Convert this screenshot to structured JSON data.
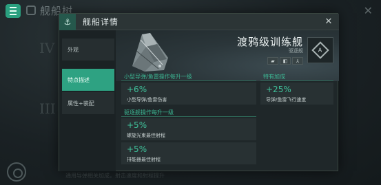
{
  "background": {
    "title": "舰船树",
    "roman_numerals": [
      "IV",
      "III"
    ],
    "hint": "通用导弹相关加成，射击速度和射程提升"
  },
  "modal": {
    "title": "舰船详情",
    "close_glyph": "✕",
    "head_icon_glyph": "⚓"
  },
  "sidebar": {
    "items": [
      {
        "label": "外观",
        "active": false
      },
      {
        "label": "特点描述",
        "active": true
      },
      {
        "label": "属性+装配",
        "active": false
      }
    ]
  },
  "ship": {
    "name": "渡鸦级训练舰",
    "class": "驱逐舰",
    "tags": [
      "▰",
      "◧",
      "⅄"
    ],
    "type_icon_letter": "A"
  },
  "sections": {
    "left": {
      "title": "小型导弹/鱼雷操作每升一级",
      "bonuses": [
        {
          "value": "+6%",
          "desc": "小型导弹/鱼雷伤害"
        }
      ]
    },
    "right": {
      "title": "特有加成",
      "bonuses": [
        {
          "value": "+25%",
          "desc": "导弹/鱼雷飞行速度"
        }
      ]
    },
    "lower": {
      "title": "驱逐舰操作每升一级",
      "bonuses": [
        {
          "value": "+5%",
          "desc": "螺旋光束最佳射程"
        },
        {
          "value": "+5%",
          "desc": "排能器最佳射程"
        }
      ]
    }
  },
  "colors": {
    "accent": "#2ea282",
    "value_green": "#3fc29b",
    "panel": "#1f2729"
  }
}
